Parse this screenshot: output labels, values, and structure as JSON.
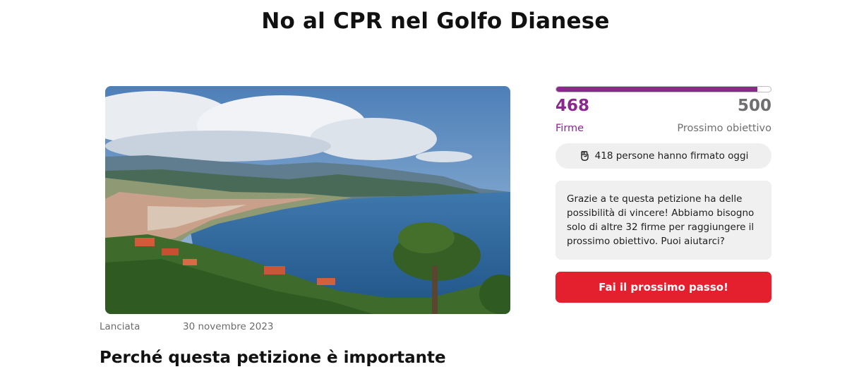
{
  "petition": {
    "title": "No al CPR nel Golfo Dianese",
    "launch_label": "Lanciata",
    "launch_date": "30 novembre 2023",
    "why_heading": "Perché questa petizione è importante"
  },
  "signatures": {
    "current": "468",
    "goal": "500",
    "current_label": "Firme",
    "goal_label": "Prossimo obiettivo",
    "progress_fraction": 0.936,
    "today_text": "418 persone hanno firmato oggi",
    "today_icon": "raised-fist-icon",
    "encouragement": "Grazie a te questa petizione ha delle possibilità di vincere! Abbiamo bisogno solo di altre 32 firme per raggiungere il prossimo obiettivo. Puoi aiutarci?"
  },
  "cta": {
    "label": "Fai il prossimo passo!"
  },
  "colors": {
    "accent_purple": "#8a2890",
    "cta_red": "#e4202f",
    "muted_gray": "#6f6f6f"
  }
}
